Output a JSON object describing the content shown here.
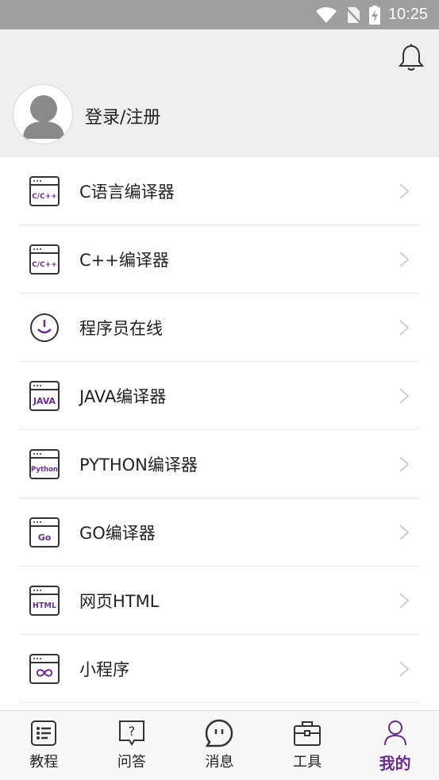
{
  "status_bar": {
    "time": "10:25"
  },
  "header": {
    "login_label": "登录/注册"
  },
  "menu": {
    "items": [
      {
        "label": "C语言编译器",
        "badge": "C/C++",
        "icon": "c-compiler-icon"
      },
      {
        "label": "C++编译器",
        "badge": "C/C++",
        "icon": "cpp-compiler-icon"
      },
      {
        "label": "程序员在线",
        "badge": "",
        "icon": "programmer-online-icon"
      },
      {
        "label": "JAVA编译器",
        "badge": "JAVA",
        "icon": "java-compiler-icon"
      },
      {
        "label": "PYTHON编译器",
        "badge": "Python",
        "icon": "python-compiler-icon"
      },
      {
        "label": "GO编译器",
        "badge": "Go",
        "icon": "go-compiler-icon"
      },
      {
        "label": "网页HTML",
        "badge": "HTML",
        "icon": "html-icon"
      },
      {
        "label": "小程序",
        "badge": "",
        "icon": "mini-program-icon"
      }
    ]
  },
  "tabs": [
    {
      "label": "教程",
      "icon": "tutorial-icon",
      "active": false
    },
    {
      "label": "问答",
      "icon": "qa-icon",
      "active": false
    },
    {
      "label": "消息",
      "icon": "message-icon",
      "active": false
    },
    {
      "label": "工具",
      "icon": "toolbox-icon",
      "active": false
    },
    {
      "label": "我的",
      "icon": "profile-icon",
      "active": true
    }
  ],
  "colors": {
    "accent": "#6a2c8c",
    "header_bg": "#efefef",
    "status_bg": "#9e9e9e"
  }
}
